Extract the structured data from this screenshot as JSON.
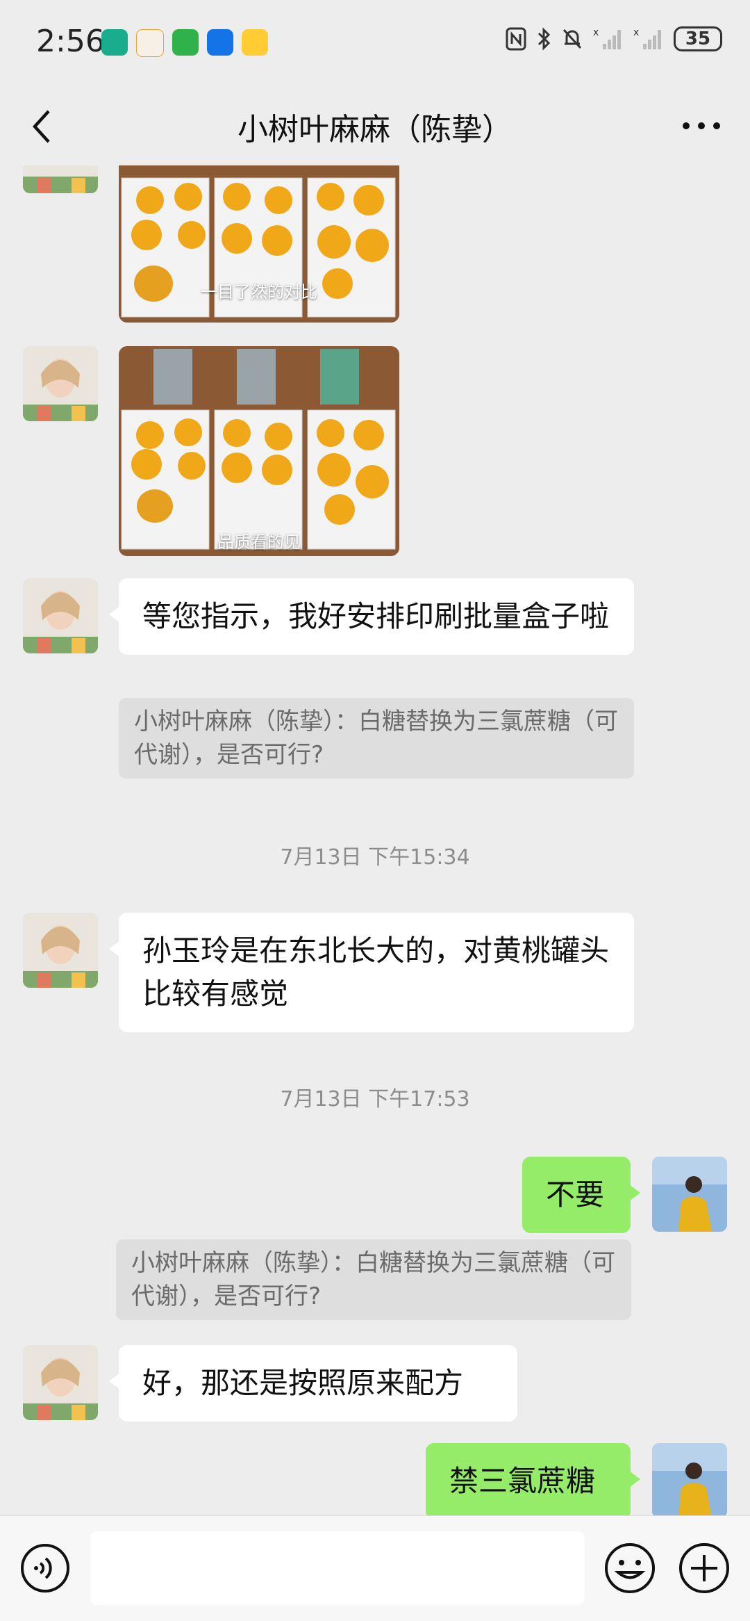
{
  "status_bar": {
    "time": "2:56",
    "battery": "35"
  },
  "header": {
    "title": "小树叶麻麻（陈挚）"
  },
  "messages": {
    "image1_caption": "一目了然的对比",
    "image2_caption": "品质看的见",
    "msg1": "等您指示，我好安排印刷批量盒子啦",
    "quote1": "小树叶麻麻（陈挚）：白糖替换为三氯蔗糖（可代谢），是否可行?",
    "time1": "7月13日 下午15:34",
    "msg2": "孙玉玲是在东北长大的，对黄桃罐头比较有感觉",
    "time2": "7月13日 下午17:53",
    "msg3": "不要",
    "quote2": "小树叶麻麻（陈挚）：白糖替换为三氯蔗糖（可代谢），是否可行?",
    "msg4": "好，那还是按照原来配方",
    "msg5": "禁三氯蔗糖"
  },
  "colors": {
    "my_bubble": "#95ec69",
    "their_bubble": "#ffffff",
    "background": "#ededed"
  }
}
